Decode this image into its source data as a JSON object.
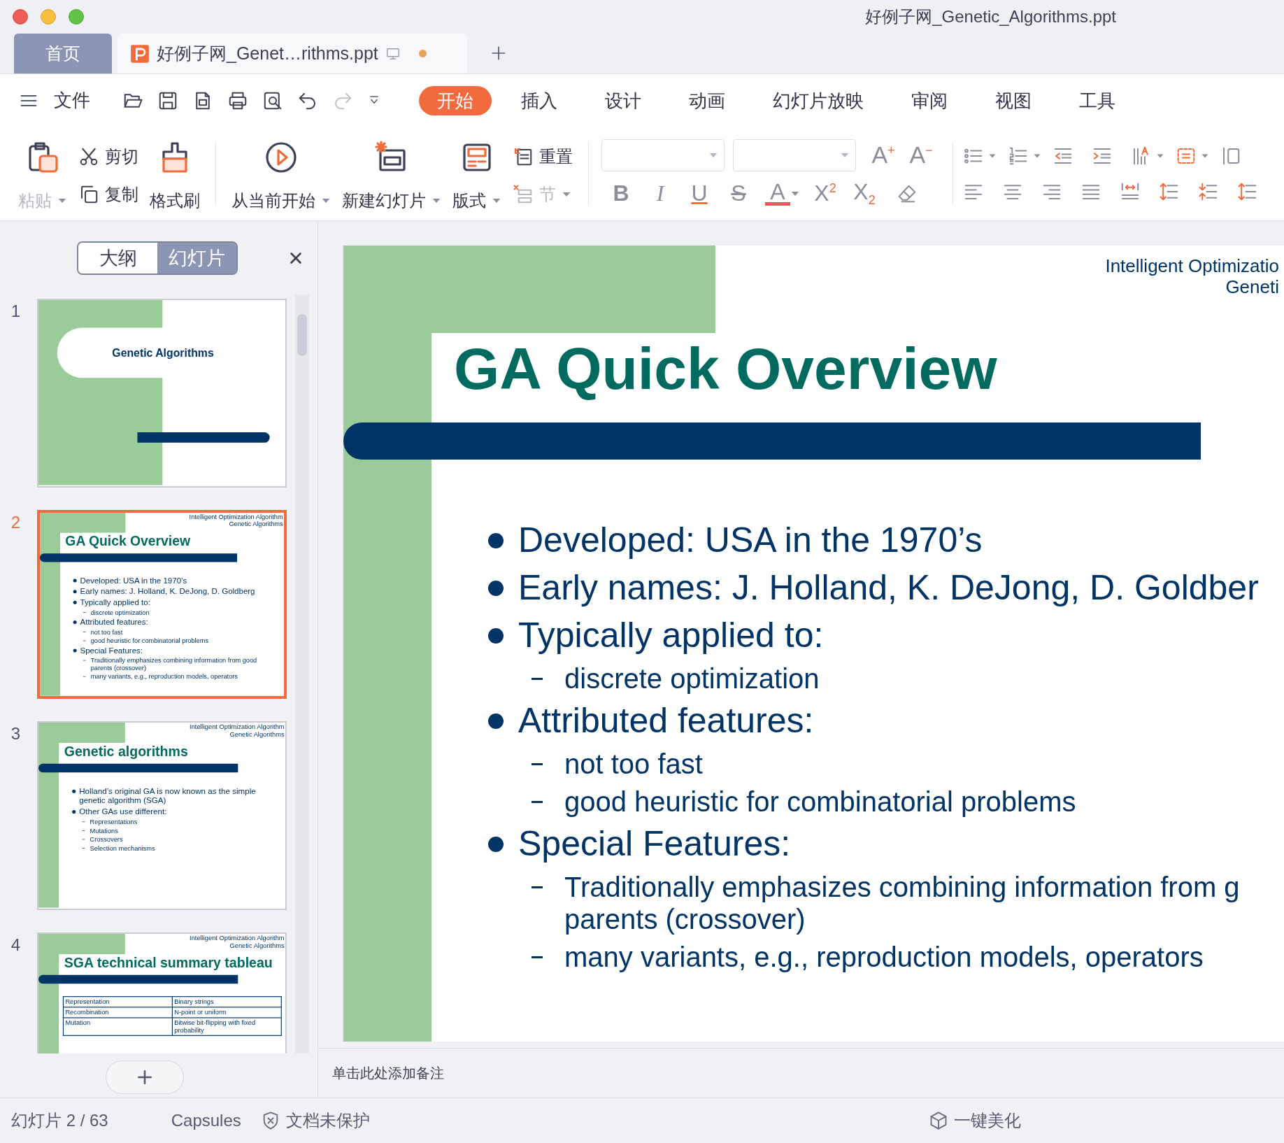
{
  "window": {
    "title": "好例子网_Genetic_Algorithms.ppt"
  },
  "tabs": [
    {
      "label": "首页",
      "kind": "home",
      "selected": false
    },
    {
      "label": "好例子网_Genet…rithms.ppt",
      "kind": "document",
      "selected": true,
      "unsaved": true
    }
  ],
  "menu": {
    "file": "文件",
    "tabs": [
      {
        "label": "开始",
        "selected": true
      },
      {
        "label": "插入",
        "selected": false
      },
      {
        "label": "设计",
        "selected": false
      },
      {
        "label": "动画",
        "selected": false
      },
      {
        "label": "幻灯片放映",
        "selected": false
      },
      {
        "label": "审阅",
        "selected": false
      },
      {
        "label": "视图",
        "selected": false
      },
      {
        "label": "工具",
        "selected": false
      }
    ]
  },
  "ribbon": {
    "paste": {
      "label": "粘贴",
      "disabled": true
    },
    "cut": "剪切",
    "copy": "复制",
    "format_painter": "格式刷",
    "play_from_current": "从当前开始",
    "new_slide": "新建幻灯片",
    "layout": "版式",
    "reset": "重置",
    "section": {
      "label": "节",
      "disabled": true
    },
    "size_buttons": [
      "A$^{+}$",
      "A$^{−}$"
    ],
    "format_buttons": [
      {
        "kind": "bold",
        "label": "B"
      },
      {
        "kind": "italic",
        "label": "I"
      },
      {
        "kind": "underline",
        "label": "U"
      },
      {
        "kind": "strike",
        "label": "S"
      },
      {
        "kind": "color",
        "label": "A"
      },
      {
        "kind": "superscript",
        "label": "X$^{2}$"
      },
      {
        "kind": "subscript",
        "label": "X$_{2}$"
      }
    ]
  },
  "sidebar": {
    "view_toggle": [
      {
        "label": "大纲",
        "selected": false
      },
      {
        "label": "幻灯片",
        "selected": true
      }
    ],
    "slides": [
      {
        "number": "1",
        "selected": false,
        "kind": "title",
        "title": "Genetic Algorithms"
      },
      {
        "number": "2",
        "selected": true,
        "kind": "bullets",
        "header": [
          "Intelligent Optimization Algorithm",
          "Genetic Algorithms"
        ],
        "title": "GA Quick Overview",
        "bullets": [
          {
            "text": "Developed: USA in the 1970’s"
          },
          {
            "text": "Early names: J. Holland, K. DeJong, D. Goldberg"
          },
          {
            "text": "Typically applied to:",
            "children": [
              {
                "text": "discrete optimization"
              }
            ]
          },
          {
            "text": "Attributed features:",
            "children": [
              {
                "text": "not too fast"
              },
              {
                "text": "good heuristic for combinatorial problems"
              }
            ]
          },
          {
            "text": "Special Features:",
            "children": [
              {
                "text": "Traditionally emphasizes combining information from good parents (crossover)"
              },
              {
                "text": "many variants, e.g., reproduction models, operators"
              }
            ]
          }
        ]
      },
      {
        "number": "3",
        "selected": false,
        "kind": "bullets",
        "header": [
          "Intelligent Optimization Algorithm",
          "Genetic Algorithms"
        ],
        "title": "Genetic algorithms",
        "bullets": [
          {
            "text": "Holland’s original GA is now known as the simple genetic algorithm (SGA)"
          },
          {
            "text": "Other GAs use different:",
            "children": [
              {
                "text": "Representations"
              },
              {
                "text": "Mutations"
              },
              {
                "text": "Crossovers"
              },
              {
                "text": "Selection mechanisms"
              }
            ]
          }
        ]
      },
      {
        "number": "4",
        "selected": false,
        "kind": "table",
        "header": [
          "Intelligent Optimization Algorithm",
          "Genetic Algorithms"
        ],
        "title": "SGA technical summary tableau",
        "table": [
          [
            "Representation",
            "Binary strings"
          ],
          [
            "Recombination",
            "N-point or uniform"
          ],
          [
            "Mutation",
            "Bitwise bit-flipping with fixed probability"
          ]
        ]
      }
    ]
  },
  "current_slide": {
    "kind": "bullets",
    "header": [
      "Intelligent Optimizatio",
      "Geneti"
    ],
    "title": "GA Quick Overview",
    "bullets": [
      {
        "text": "Developed: USA in the 1970’s"
      },
      {
        "text": "Early names: J. Holland, K. DeJong, D. Goldber"
      },
      {
        "text": "Typically applied to:",
        "children": [
          {
            "text": "discrete optimization"
          }
        ]
      },
      {
        "text": "Attributed features:",
        "children": [
          {
            "text": "not too fast"
          },
          {
            "text": "good heuristic for combinatorial problems"
          }
        ]
      },
      {
        "text": "Special Features:",
        "children": [
          {
            "text": "Traditionally emphasizes combining information from g parents (crossover)"
          },
          {
            "text": "many variants, e.g., reproduction models, operators"
          }
        ]
      }
    ]
  },
  "notes": {
    "placeholder": "单击此处添加备注"
  },
  "status_bar": {
    "slide_counter": "幻灯片 2 / 63",
    "theme": "Capsules",
    "protection": "文档未保护",
    "beautify": "一键美化"
  }
}
